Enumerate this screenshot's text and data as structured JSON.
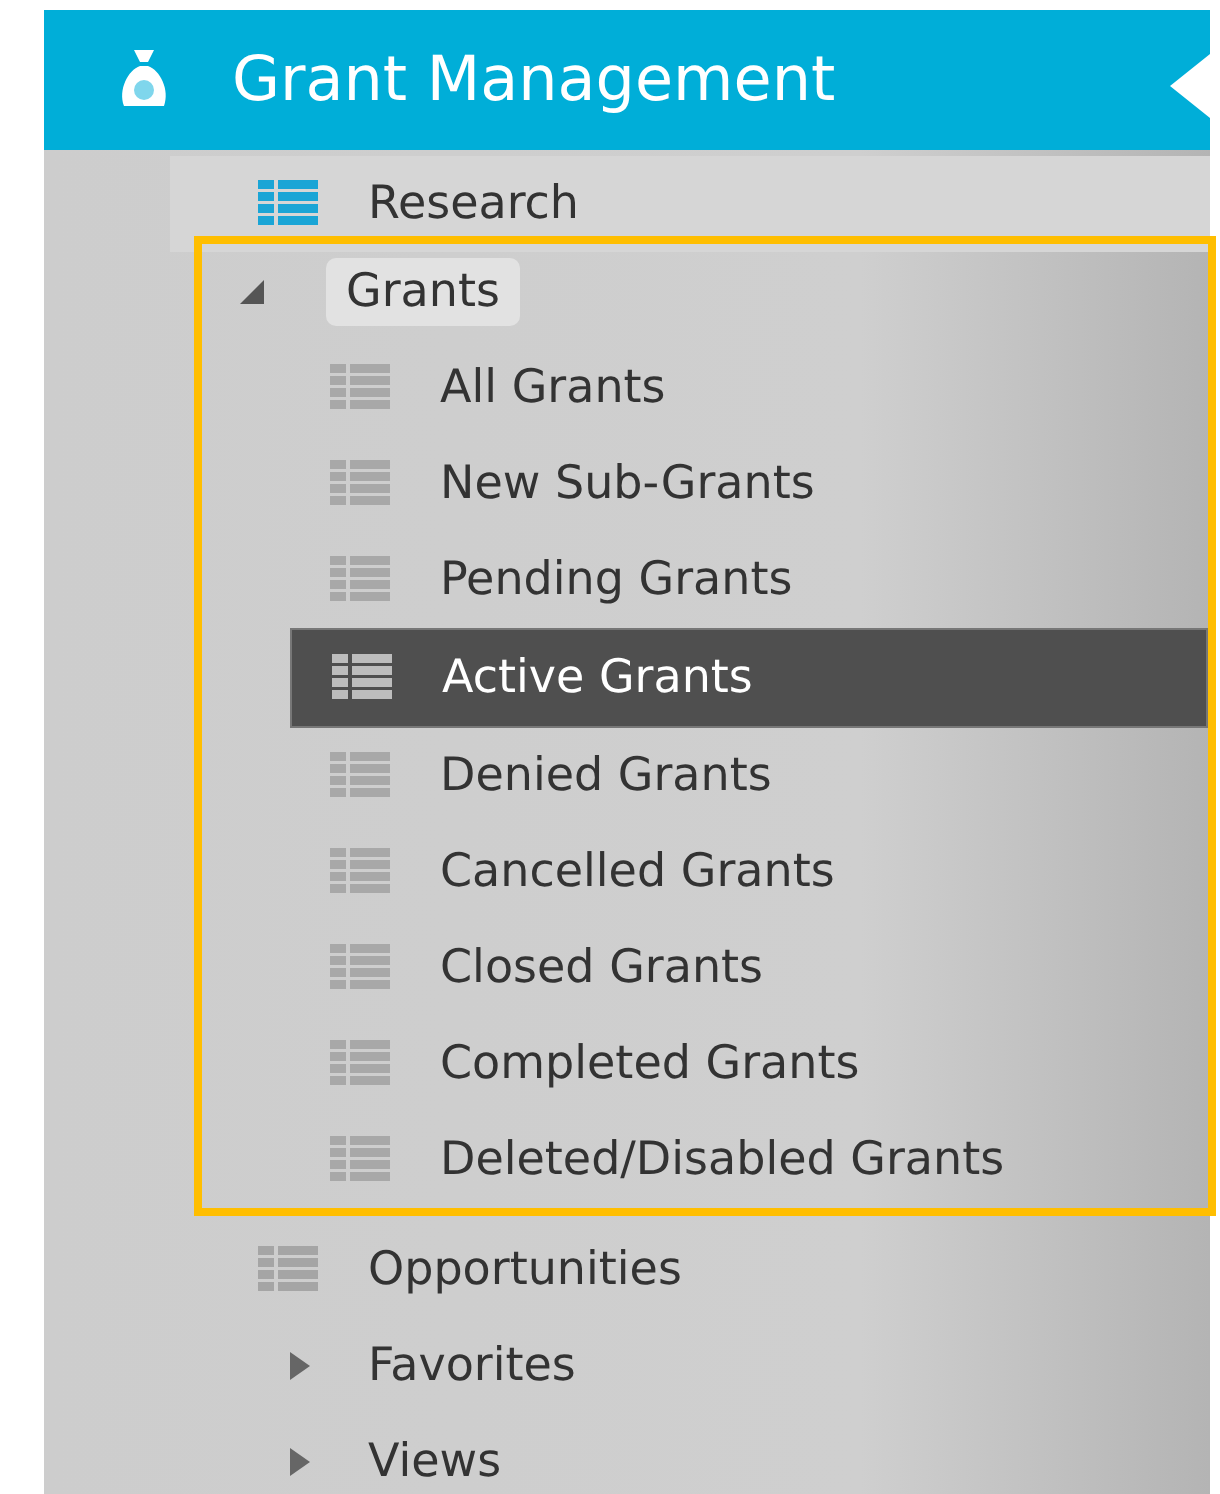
{
  "header": {
    "title": "Grant Management"
  },
  "nav": [
    {
      "label": "Research",
      "kind": "list",
      "current": true
    },
    {
      "label": "Grants",
      "kind": "group",
      "expanded": true,
      "highlighted": true,
      "children": [
        {
          "label": "All Grants",
          "selected": false
        },
        {
          "label": "New Sub-Grants",
          "selected": false
        },
        {
          "label": "Pending Grants",
          "selected": false
        },
        {
          "label": "Active Grants",
          "selected": true
        },
        {
          "label": "Denied Grants",
          "selected": false
        },
        {
          "label": "Cancelled Grants",
          "selected": false
        },
        {
          "label": "Closed Grants",
          "selected": false
        },
        {
          "label": "Completed Grants",
          "selected": false
        },
        {
          "label": "Deleted/Disabled Grants",
          "selected": false
        }
      ]
    },
    {
      "label": "Opportunities",
      "kind": "list",
      "current": false
    },
    {
      "label": "Favorites",
      "kind": "group",
      "expanded": false
    },
    {
      "label": "Views",
      "kind": "group",
      "expanded": false
    }
  ]
}
